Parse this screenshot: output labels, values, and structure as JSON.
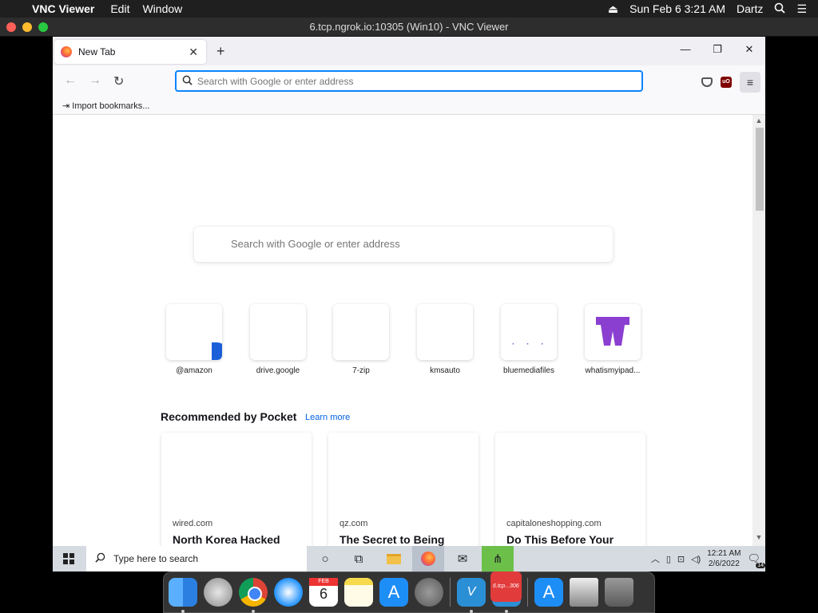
{
  "mac_menubar": {
    "app_name": "VNC Viewer",
    "menus": [
      "Edit",
      "Window"
    ],
    "datetime": "Sun Feb 6  3:21 AM",
    "user": "Dartz"
  },
  "vnc_window": {
    "title": "6.tcp.ngrok.io:10305 (Win10) - VNC Viewer"
  },
  "firefox": {
    "tab_title": "New Tab",
    "urlbar_placeholder": "Search with Google or enter address",
    "bookmark_item": "Import bookmarks...",
    "newtab": {
      "search_placeholder": "Search with Google or enter address",
      "shortcuts": [
        {
          "label": "@amazon"
        },
        {
          "label": "drive.google"
        },
        {
          "label": "7-zip"
        },
        {
          "label": "kmsauto"
        },
        {
          "label": "bluemediafiles"
        },
        {
          "label": "whatismyipad..."
        }
      ],
      "pocket": {
        "title": "Recommended by Pocket",
        "learn_more": "Learn more",
        "cards": [
          {
            "domain": "wired.com",
            "headline": "North Korea Hacked"
          },
          {
            "domain": "qz.com",
            "headline": "The Secret to Being"
          },
          {
            "domain": "capitaloneshopping.com",
            "headline": "Do This Before Your"
          }
        ]
      }
    }
  },
  "taskbar": {
    "search_placeholder": "Type here to search",
    "time": "12:21 AM",
    "date": "2/6/2022",
    "notification_count": "14"
  },
  "dock": {
    "calendar_month": "FEB",
    "calendar_day": "6",
    "vnc_badge": "6.tcp...306"
  }
}
